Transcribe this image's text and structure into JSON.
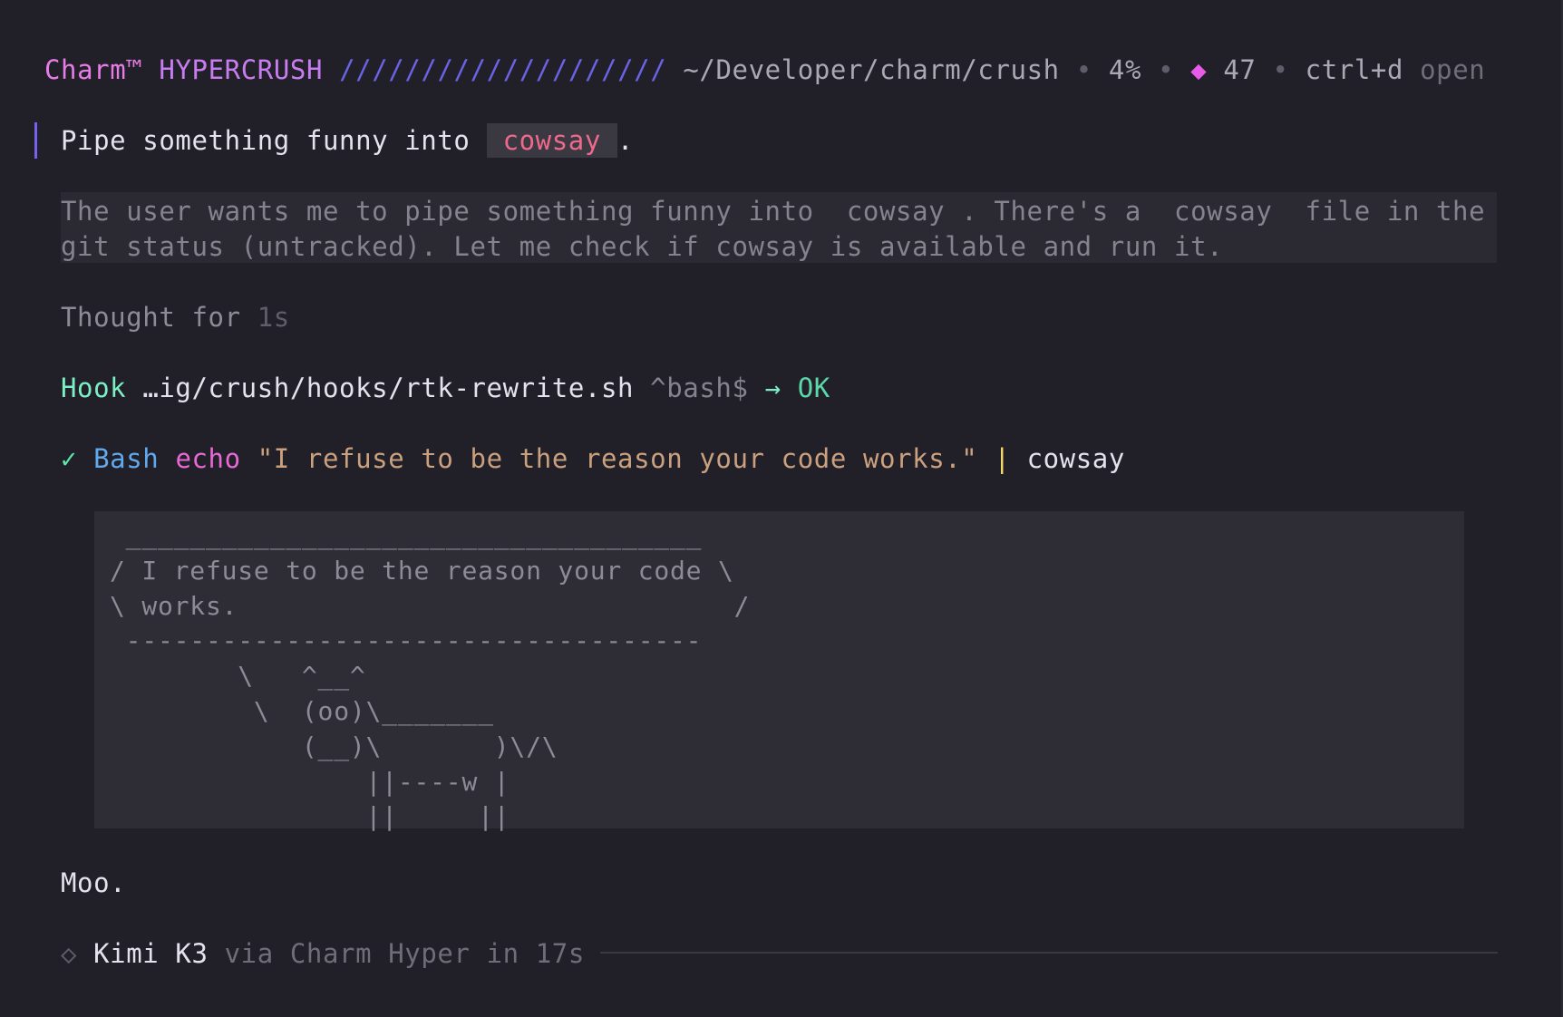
{
  "header": {
    "brand_charm": "Charm™",
    "brand_product": "HYPERCRUSH",
    "decoration": "////////////////////",
    "cwd": "~/Developer/charm/crush",
    "separator": "•",
    "context_percent": "4%",
    "token_icon": "◆",
    "token_count": "47",
    "shortcut_key": "ctrl+d",
    "shortcut_action": "open"
  },
  "prompt": {
    "text_before": "Pipe something funny into",
    "code": "cowsay",
    "text_after": "."
  },
  "thinking": {
    "line1": "The user wants me to pipe something funny into  cowsay . There's a  cowsay  file in the",
    "line2": "git status (untracked). Let me check if cowsay is available and run it.",
    "duration_label": "Thought for",
    "duration": "1s"
  },
  "hook": {
    "label": "Hook",
    "path": "…ig/crush/hooks/rtk-rewrite.sh",
    "pattern": "^bash$",
    "arrow": "→",
    "status": "OK"
  },
  "tool_call": {
    "status_icon": "✓",
    "tool": "Bash",
    "command_keyword": "echo",
    "argument": "\"I refuse to be the reason your code works.\"",
    "pipe": "|",
    "piped_command": "cowsay"
  },
  "output": {
    "text": " ____________________________________\n/ I refuse to be the reason your code \\\n\\ works.                               /\n ------------------------------------\n        \\   ^__^\n         \\  (oo)\\_______\n            (__)\\       )\\/\\\n                ||----w |\n                ||     ||"
  },
  "response": {
    "text": "Moo."
  },
  "footer": {
    "icon": "◇",
    "model": "Kimi K3",
    "provider_text": "via Charm Hyper in 17s"
  },
  "colors": {
    "background": "#212028",
    "brand_pink": "#e77ce6",
    "brand_purple": "#c77cf0",
    "accent_indigo": "#6b63e6",
    "code_pink": "#f0698c",
    "success_green": "#5cd7a8",
    "tool_blue": "#61a9ee",
    "string_tan": "#caa07e"
  }
}
